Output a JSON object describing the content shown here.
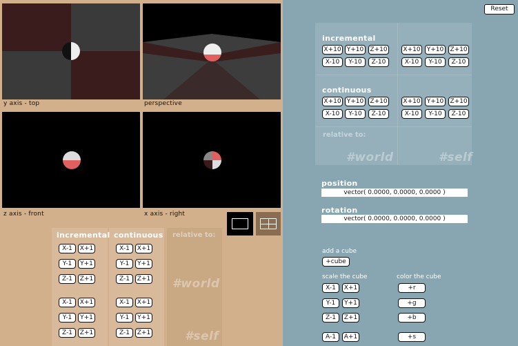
{
  "reset_label": "Reset",
  "viewports": {
    "top": {
      "label": "y axis - top"
    },
    "perspective": {
      "label": "perspective"
    },
    "front": {
      "label": "z axis - front"
    },
    "right": {
      "label": "x axis - right"
    }
  },
  "left_controls": {
    "incremental_label": "incremental",
    "continuous_label": "continuous",
    "relative_label": "relative to:",
    "world_label": "#world",
    "self_label": "#self",
    "buttons": {
      "x_minus": "X-1",
      "x_plus": "X+1",
      "y_minus": "Y-1",
      "y_plus": "Y+1",
      "z_minus": "Z-1",
      "z_plus": "Z+1"
    }
  },
  "right_controls": {
    "incremental_label": "incremental",
    "continuous_label": "continuous",
    "relative_label": "relative to:",
    "world_label": "#world",
    "self_label": "#self",
    "buttons": {
      "x_plus": "X+10",
      "y_plus": "Y+10",
      "z_plus": "Z+10",
      "x_minus": "X-10",
      "y_minus": "Y-10",
      "z_minus": "Z-10"
    },
    "position_label": "position",
    "position_value": "vector( 0.0000, 0.0000, 0.0000 )",
    "rotation_label": "rotation",
    "rotation_value": "vector( 0.0000, 0.0000, 0.0000 )",
    "add_cube_label": "add a cube",
    "add_cube_button": "+cube",
    "scale_label": "scale the cube",
    "color_label": "color the cube",
    "scale_buttons": {
      "x_minus": "X-1",
      "x_plus": "X+1",
      "y_minus": "Y-1",
      "y_plus": "Y+1",
      "z_minus": "Z-1",
      "z_plus": "Z+1",
      "a_minus": "A-1",
      "a_plus": "A+1"
    },
    "color_buttons": {
      "r": "+r",
      "g": "+g",
      "b": "+b",
      "s": "+s"
    }
  },
  "colors": {
    "left_bg": "#d3b08c",
    "right_bg": "#87a6b1",
    "viewport_bg": "#000000",
    "dark_red": "#3a1a1a",
    "sphere_red": "#e06060"
  },
  "icons": {
    "single_view": "single-view-icon",
    "quad_view": "quad-view-icon"
  }
}
